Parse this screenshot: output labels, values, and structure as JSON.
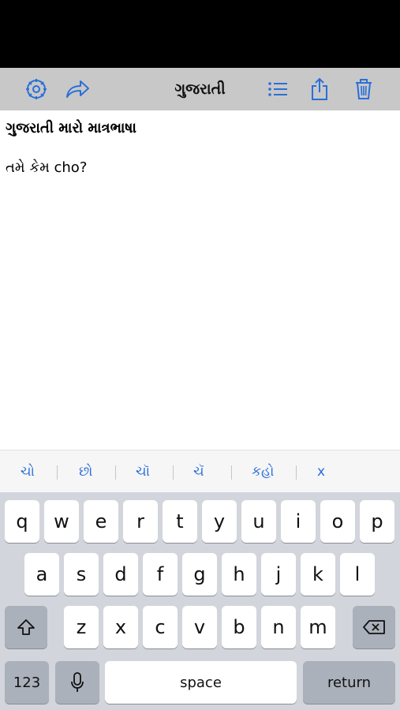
{
  "toolbar": {
    "title": "ગુજરાતી",
    "accent_color": "#2a6fd9",
    "icons": [
      "settings-icon",
      "share-forward-icon",
      "list-icon",
      "export-icon",
      "trash-icon"
    ]
  },
  "editor": {
    "line1": "ગુજરાતી મારો માત્રભાષા",
    "line2": "તમે કેમ cho?"
  },
  "suggestions": [
    "ચો",
    "છો",
    "ચૉ",
    "ચૅ",
    "કહો",
    "x"
  ],
  "keyboard": {
    "row1": [
      "q",
      "w",
      "e",
      "r",
      "t",
      "y",
      "u",
      "i",
      "o",
      "p"
    ],
    "row2": [
      "a",
      "s",
      "d",
      "f",
      "g",
      "h",
      "j",
      "k",
      "l"
    ],
    "row3": [
      "z",
      "x",
      "c",
      "v",
      "b",
      "n",
      "m"
    ],
    "numbers_label": "123",
    "space_label": "space",
    "return_label": "return",
    "shift_icon": "shift-icon",
    "delete_icon": "backspace-icon",
    "mic_icon": "microphone-icon"
  }
}
